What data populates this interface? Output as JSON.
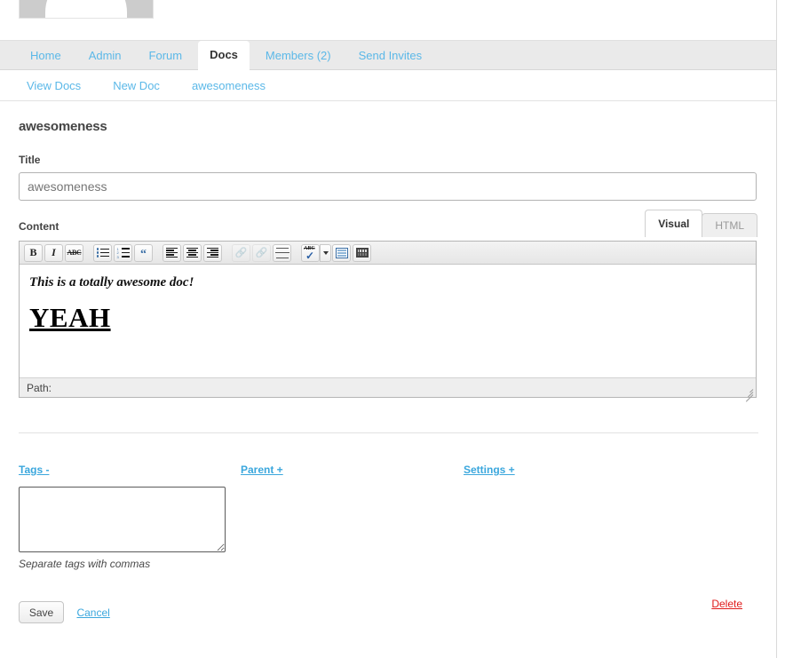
{
  "header": {
    "avatar_alt": "group avatar"
  },
  "primary_nav": {
    "items": [
      {
        "label": "Home",
        "active": false
      },
      {
        "label": "Admin",
        "active": false
      },
      {
        "label": "Forum",
        "active": false
      },
      {
        "label": "Docs",
        "active": true
      },
      {
        "label": "Members (2)",
        "active": false
      },
      {
        "label": "Send Invites",
        "active": false
      }
    ]
  },
  "secondary_nav": {
    "items": [
      {
        "label": "View Docs"
      },
      {
        "label": "New Doc"
      },
      {
        "label": "awesomeness"
      }
    ]
  },
  "main": {
    "page_title": "awesomeness",
    "title_field": {
      "label": "Title",
      "value": "awesomeness",
      "placeholder": "awesomeness"
    },
    "content_field": {
      "label": "Content"
    },
    "editor_tabs": [
      {
        "label": "Visual",
        "active": true
      },
      {
        "label": "HTML",
        "active": false
      }
    ],
    "editor": {
      "toolbar": [
        {
          "name": "bold-icon",
          "title": "Bold",
          "disabled": false
        },
        {
          "name": "italic-icon",
          "title": "Italic",
          "disabled": false
        },
        {
          "name": "strikethrough-icon",
          "title": "Strikethrough",
          "disabled": false
        },
        {
          "name": "unordered-list-icon",
          "title": "Unordered list",
          "disabled": false
        },
        {
          "name": "ordered-list-icon",
          "title": "Ordered list",
          "disabled": false
        },
        {
          "name": "blockquote-icon",
          "title": "Blockquote",
          "disabled": false
        },
        {
          "name": "align-left-icon",
          "title": "Align left",
          "disabled": false
        },
        {
          "name": "align-center-icon",
          "title": "Align center",
          "disabled": false
        },
        {
          "name": "align-right-icon",
          "title": "Align right",
          "disabled": false
        },
        {
          "name": "link-icon",
          "title": "Insert link",
          "disabled": true
        },
        {
          "name": "unlink-icon",
          "title": "Remove link",
          "disabled": true
        },
        {
          "name": "horizontal-rule-icon",
          "title": "Insert horizontal rule",
          "disabled": false
        },
        {
          "name": "spellcheck-icon",
          "title": "Toggle spellchecker",
          "disabled": false
        },
        {
          "name": "spellcheck-dropdown-icon",
          "title": "Spellchecker options",
          "disabled": false
        },
        {
          "name": "media-icon",
          "title": "Insert media",
          "disabled": false
        },
        {
          "name": "grid-icon",
          "title": "Insert table",
          "disabled": false
        }
      ],
      "content": {
        "line1": "This is a totally awesome doc!",
        "line2": "YEAH"
      },
      "status_path": "Path:"
    },
    "meta": {
      "tags": {
        "toggle_label": "Tags -",
        "value": "",
        "hint": "Separate tags with commas"
      },
      "parent": {
        "toggle_label": "Parent +"
      },
      "settings": {
        "toggle_label": "Settings +"
      }
    },
    "actions": {
      "save_label": "Save",
      "cancel_label": "Cancel",
      "delete_label": "Delete"
    }
  },
  "colors": {
    "link": "#3ba7dd",
    "nav_link": "#5bb8e8",
    "delete": "#e01b1b",
    "nav_bg": "#eaeaea",
    "editor_toolbar_bg": "#ececec"
  }
}
